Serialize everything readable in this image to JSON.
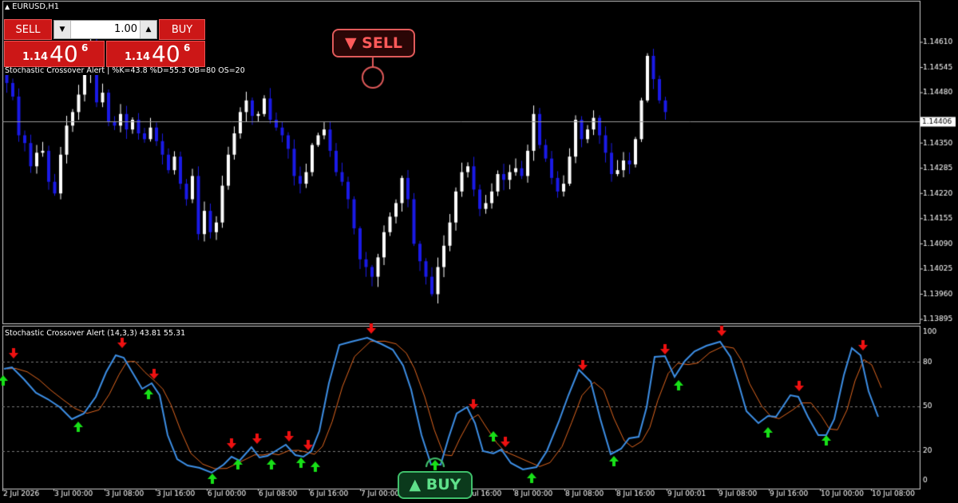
{
  "window": {
    "title": "EURUSD,H1"
  },
  "trade_panel": {
    "sell_label": "SELL",
    "buy_label": "BUY",
    "lot_size": "1.00",
    "sell_price": {
      "prefix": "1.14",
      "big": "40",
      "sup": "6"
    },
    "buy_price": {
      "prefix": "1.14",
      "big": "40",
      "sup": "6"
    }
  },
  "main_indicator_label": "Stochastic Crossover Alert | %K=43.8  %D=55.3  OB=80 OS=20",
  "sub_indicator_label": "Stochastic Crossover Alert (14,3,3) 43.81 55.31",
  "callouts": {
    "sell": "▼ SELL",
    "buy": "▲ BUY"
  },
  "colors": {
    "background": "#000000",
    "bull_candle": "#ffffff",
    "bear_candle": "#1a1ae6",
    "k_line": "#3d8fe6",
    "d_line": "#e0661f",
    "up_arrow": "#18e018",
    "down_arrow": "#ee1111",
    "panel_red": "#cc1717"
  },
  "price_axis": {
    "labels": [
      "1.14610",
      "1.14545",
      "1.14480",
      "1.14350",
      "1.14285",
      "1.14220",
      "1.14155",
      "1.14090",
      "1.14025",
      "1.13960",
      "1.13895"
    ],
    "current_price": "1.14406"
  },
  "stoch_axis": {
    "labels": [
      "100",
      "80",
      "50",
      "20",
      "0"
    ]
  },
  "time_axis": {
    "labels": [
      "2 Jul 2026",
      "3 Jul 00:00",
      "3 Jul 08:00",
      "3 Jul 16:00",
      "6 Jul 00:00",
      "6 Jul 08:00",
      "6 Jul 16:00",
      "7 Jul 00:00",
      "7 Jul 08:00",
      "7 Jul 16:00",
      "8 Jul 00:00",
      "8 Jul 08:00",
      "8 Jul 16:00",
      "9 Jul 00:01",
      "9 Jul 08:00",
      "9 Jul 16:00",
      "10 Jul 00:00",
      "10 Jul 08:00"
    ]
  },
  "chart_data": {
    "type": "candlestick",
    "symbol": "EURUSD",
    "timeframe": "H1",
    "ylim": [
      1.13895,
      1.14645
    ],
    "current_price": 1.14406,
    "closes": [
      1.14505,
      1.1447,
      1.1437,
      1.1435,
      1.1429,
      1.14325,
      1.1433,
      1.1425,
      1.1422,
      1.1432,
      1.14395,
      1.1443,
      1.14475,
      1.1453,
      1.14605,
      1.14455,
      1.1448,
      1.14405,
      1.14395,
      1.14425,
      1.14385,
      1.1441,
      1.14375,
      1.1436,
      1.1439,
      1.14355,
      1.1432,
      1.1428,
      1.14315,
      1.14245,
      1.14205,
      1.14265,
      1.14115,
      1.14175,
      1.1412,
      1.14145,
      1.1424,
      1.1432,
      1.14375,
      1.1443,
      1.1446,
      1.1442,
      1.14425,
      1.14465,
      1.1441,
      1.1439,
      1.1437,
      1.14335,
      1.14265,
      1.14245,
      1.14275,
      1.14345,
      1.1437,
      1.14385,
      1.1433,
      1.14275,
      1.1425,
      1.14205,
      1.1413,
      1.1405,
      1.1403,
      1.14005,
      1.14055,
      1.1412,
      1.1416,
      1.14195,
      1.1426,
      1.14205,
      1.1409,
      1.14045,
      1.14005,
      1.1396,
      1.1403,
      1.14085,
      1.14145,
      1.14225,
      1.14275,
      1.1429,
      1.1423,
      1.1418,
      1.14195,
      1.14225,
      1.1427,
      1.14255,
      1.14275,
      1.14285,
      1.14265,
      1.1433,
      1.14425,
      1.14345,
      1.1431,
      1.1426,
      1.14225,
      1.14245,
      1.14315,
      1.1441,
      1.1436,
      1.14385,
      1.14415,
      1.1437,
      1.14325,
      1.1427,
      1.1428,
      1.14305,
      1.14295,
      1.1436,
      1.1446,
      1.14575,
      1.14515,
      1.1446,
      1.1443
    ],
    "stochastic": {
      "params": "14,3,3",
      "k": 43.81,
      "d": 55.31,
      "levels": [
        80,
        50,
        20
      ],
      "ylim": [
        0,
        100
      ]
    }
  }
}
